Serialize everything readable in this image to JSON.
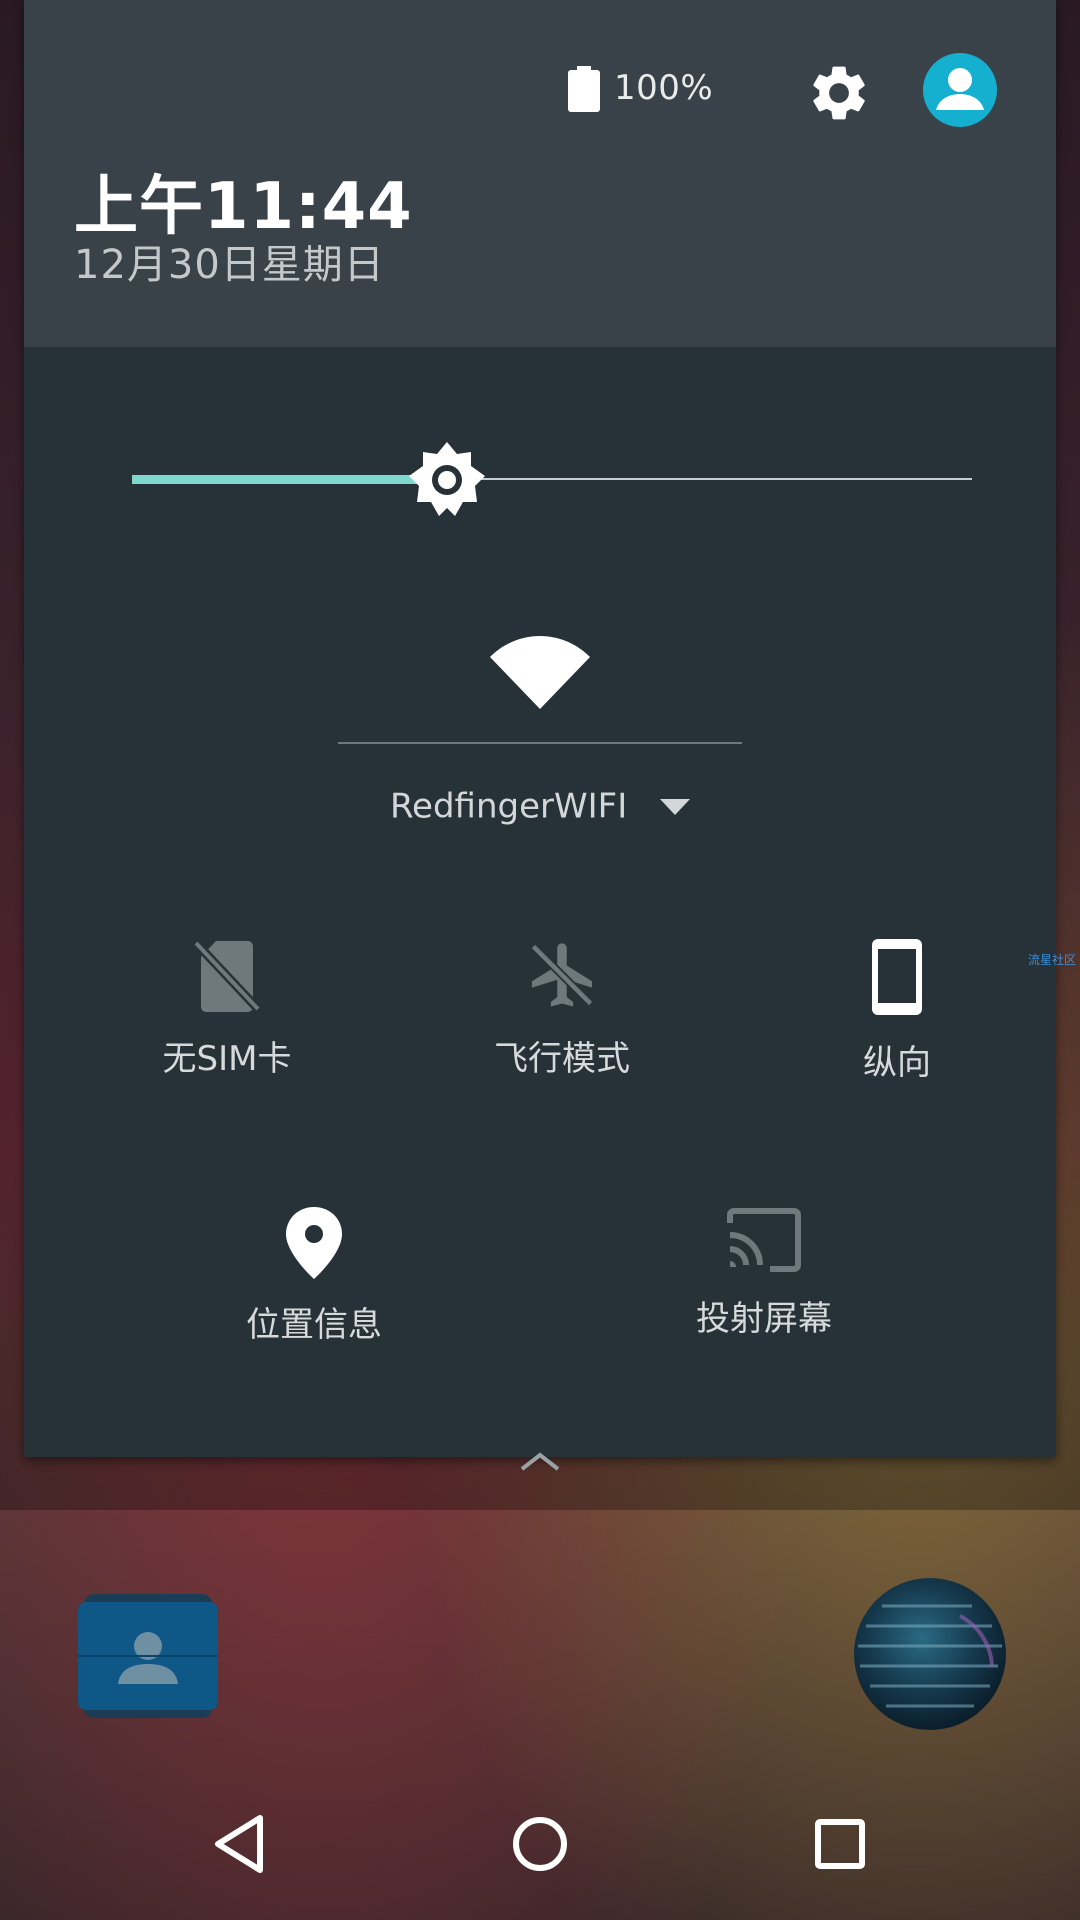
{
  "status": {
    "battery_text": "100%",
    "battery_icon": "battery-full-icon",
    "settings_icon": "gear-icon",
    "user_icon": "account-circle-icon"
  },
  "header": {
    "time": "上午11:44",
    "date": "12月30日星期日"
  },
  "brightness": {
    "level": 0.375,
    "icon": "brightness-icon"
  },
  "wifi": {
    "network": "RedfingerWIFI",
    "icon": "wifi-icon"
  },
  "tiles": [
    {
      "label": "无SIM卡",
      "icon": "no-sim-icon",
      "state": "disabled"
    },
    {
      "label": "飞行模式",
      "icon": "airplane-icon",
      "state": "disabled"
    },
    {
      "label": "纵向",
      "icon": "portrait-icon",
      "state": "enabled"
    },
    {
      "label": "位置信息",
      "icon": "location-icon",
      "state": "enabled"
    },
    {
      "label": "投射屏幕",
      "icon": "cast-icon",
      "state": "disabled"
    }
  ],
  "side_note": "流星社区",
  "colors": {
    "header_bg": "#3a4249",
    "panel_bg": "#273238",
    "accent": "#7fd8cc",
    "avatar": "#15b0cf",
    "icon_on": "#ffffff",
    "icon_off": "#6e787d",
    "side_note": "#3d8ed8"
  },
  "home": {
    "apps": [
      "contacts-app-icon",
      "globe-app-icon"
    ]
  },
  "navbar": {
    "buttons": [
      "back-icon",
      "home-icon",
      "recents-icon"
    ]
  }
}
